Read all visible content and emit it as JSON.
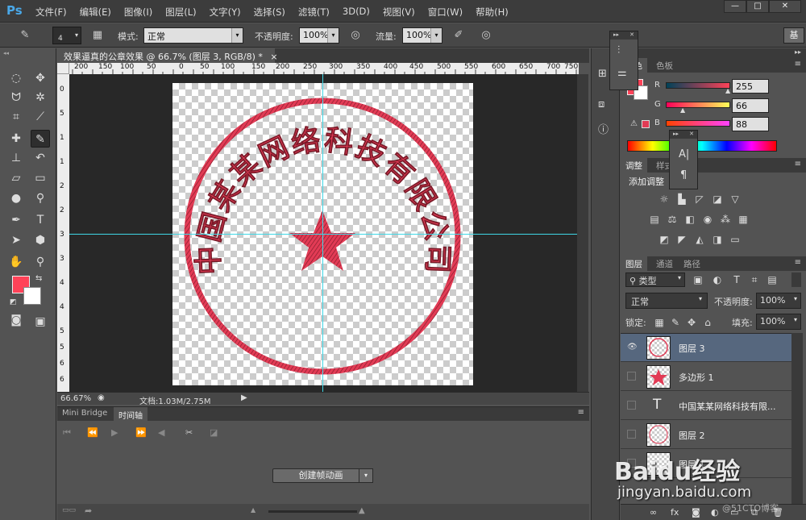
{
  "app": {
    "logo": "Ps"
  },
  "menu": [
    "文件(F)",
    "编辑(E)",
    "图像(I)",
    "图层(L)",
    "文字(Y)",
    "选择(S)",
    "滤镜(T)",
    "3D(D)",
    "视图(V)",
    "窗口(W)",
    "帮助(H)"
  ],
  "window_controls": {
    "minimize": "—",
    "maximize": "□",
    "close": "✕"
  },
  "options": {
    "brush_size": "4",
    "mode_label": "模式:",
    "mode_value": "正常",
    "opacity_label": "不透明度:",
    "opacity_value": "100%",
    "flow_label": "流量:",
    "flow_value": "100%",
    "workspace_button": "基"
  },
  "document": {
    "tab_title": "效果逼真的公章效果 @ 66.7% (图层 3, RGB/8) *",
    "tab_close": "×",
    "ruler_top_ticks": [
      "200",
      "150",
      "100",
      "50",
      "0",
      "50",
      "100",
      "150",
      "200",
      "250",
      "300",
      "350",
      "400",
      "450",
      "500",
      "550",
      "600",
      "650",
      "700",
      "750"
    ],
    "ruler_left_ticks": [
      "0",
      "5",
      "1",
      "1",
      "2",
      "2",
      "3",
      "3",
      "4",
      "4",
      "5",
      "5",
      "6",
      "6"
    ],
    "zoom": "66.67%",
    "doc_info": "文档:1.03M/2.75M"
  },
  "stamp": {
    "text": "中国某某网络科技有限公司",
    "color": "#e23b55"
  },
  "timeline": {
    "tabs": [
      "Mini Bridge",
      "时间轴"
    ],
    "active_tab": "时间轴",
    "create_button": "创建帧动画"
  },
  "color_panel": {
    "tabs": [
      "颜色",
      "色板"
    ],
    "r_label": "R",
    "r_value": "255",
    "g_label": "G",
    "g_value": "66",
    "b_label": "B",
    "b_value": "88",
    "foreground_color": "#ff4258"
  },
  "adjust_panel": {
    "tabs": [
      "调整",
      "样式"
    ],
    "title": "添加调整"
  },
  "layers_panel": {
    "tabs": [
      "图层",
      "通道",
      "路径"
    ],
    "filter_label": "类型",
    "blend_mode": "正常",
    "opacity_label": "不透明度:",
    "opacity_value": "100%",
    "lock_label": "锁定:",
    "fill_label": "填充:",
    "fill_value": "100%",
    "layers": [
      {
        "name": "图层 3",
        "visible": true,
        "selected": true
      },
      {
        "name": "多边形 1",
        "visible": false,
        "selected": false
      },
      {
        "name": "中国某某网络科技有限...",
        "visible": false,
        "selected": false,
        "type_icon": "T"
      },
      {
        "name": "图层 2",
        "visible": false,
        "selected": false
      },
      {
        "name": "图层 1",
        "visible": false,
        "selected": false
      }
    ]
  },
  "watermark": {
    "brand": "Baidu经验",
    "url": "jingyan.baidu.com",
    "credit": "@51CTO博客"
  }
}
